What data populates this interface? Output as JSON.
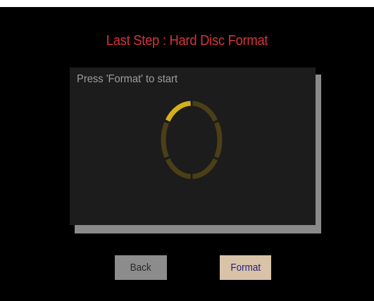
{
  "title": "Last Step : Hard Disc Format",
  "panel": {
    "instruction": "Press 'Format' to start"
  },
  "spinner": {
    "segments": 6,
    "active_segment_index": 0,
    "active_color": "#d4b01c",
    "inactive_color": "#4a3f16",
    "icon": "loading-ring-icon"
  },
  "buttons": {
    "back_label": "Back",
    "format_label": "Format"
  },
  "colors": {
    "background": "#000000",
    "title": "#d6343a",
    "panel": "#1c1c1c",
    "back_button": "#8c8c8c",
    "format_button": "#d8c3a9"
  }
}
